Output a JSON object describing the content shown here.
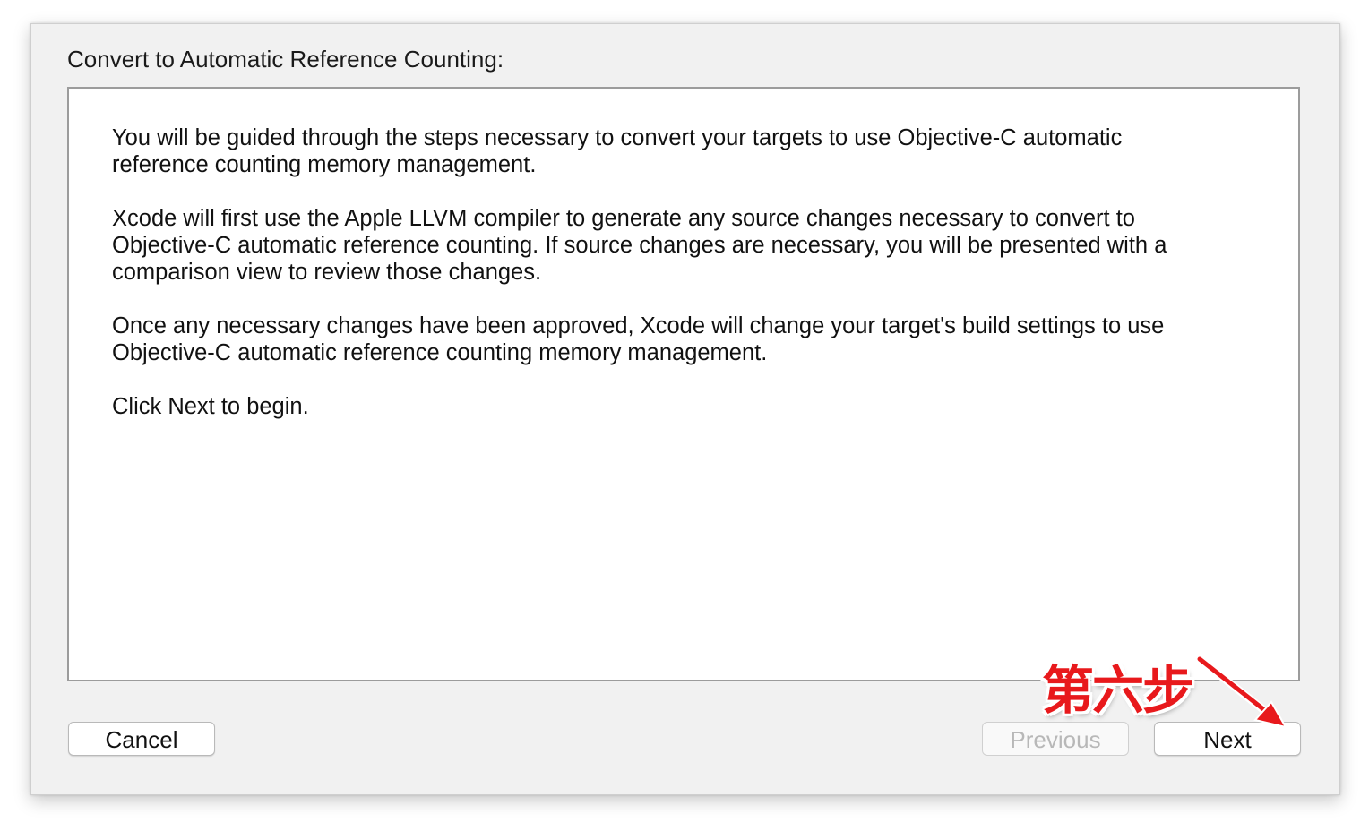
{
  "dialog": {
    "title": "Convert to Automatic Reference Counting:",
    "paragraphs": [
      "You will be guided through the steps necessary to convert your targets to use Objective-C automatic reference counting memory management.",
      "Xcode will first use the Apple LLVM compiler to generate any source changes necessary to convert to Objective-C automatic reference counting. If source changes are necessary, you will be presented with a comparison view to review those changes.",
      "Once any necessary changes have been approved, Xcode will change your target's build settings to use Objective-C automatic reference counting memory management.",
      "Click Next to begin."
    ]
  },
  "buttons": {
    "cancel": "Cancel",
    "previous": "Previous",
    "next": "Next",
    "previous_enabled": false
  },
  "annotation": {
    "text": "第六步",
    "color": "#e8191c",
    "icon": "arrow-icon"
  }
}
